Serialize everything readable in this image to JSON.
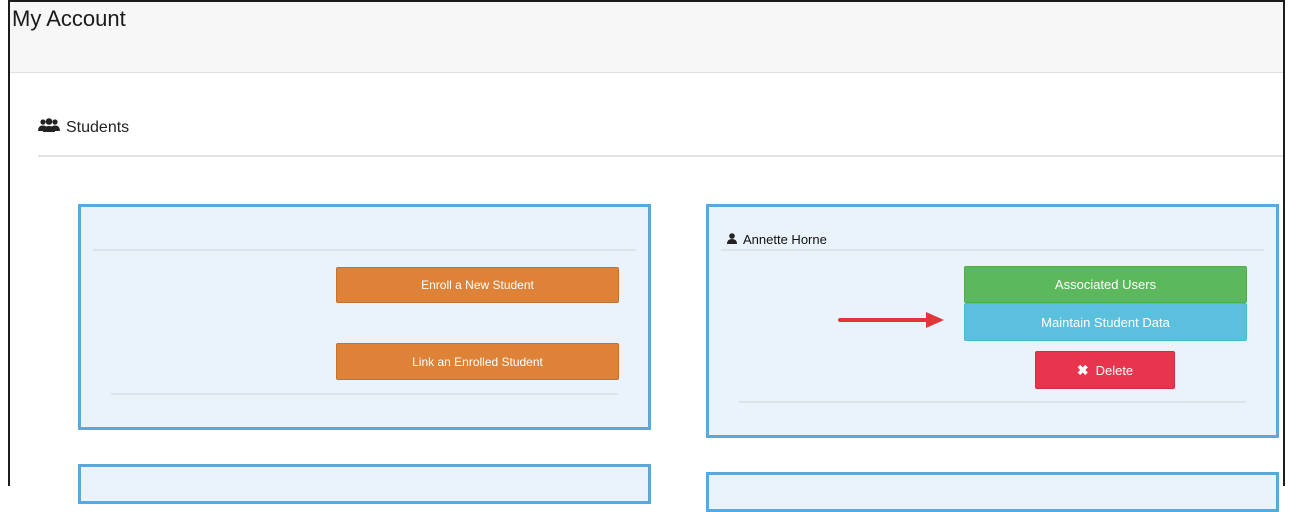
{
  "header": {
    "title": "My Account"
  },
  "students_section": {
    "heading": "Students",
    "icon": "users-icon"
  },
  "actions_card": {
    "enroll_label": "Enroll a New Student",
    "link_label": "Link an Enrolled Student"
  },
  "student_card": {
    "name": "Annette Horne",
    "icon": "user-icon",
    "associated_users_label": "Associated Users",
    "maintain_label": "Maintain Student Data",
    "delete_label": "Delete"
  },
  "colors": {
    "card_border": "#5aa9de",
    "card_bg": "#eaf3fb",
    "orange": "#de8238",
    "green": "#5cb85c",
    "blue": "#5bc0de",
    "red": "#e8344c",
    "arrow": "#e0383a"
  }
}
